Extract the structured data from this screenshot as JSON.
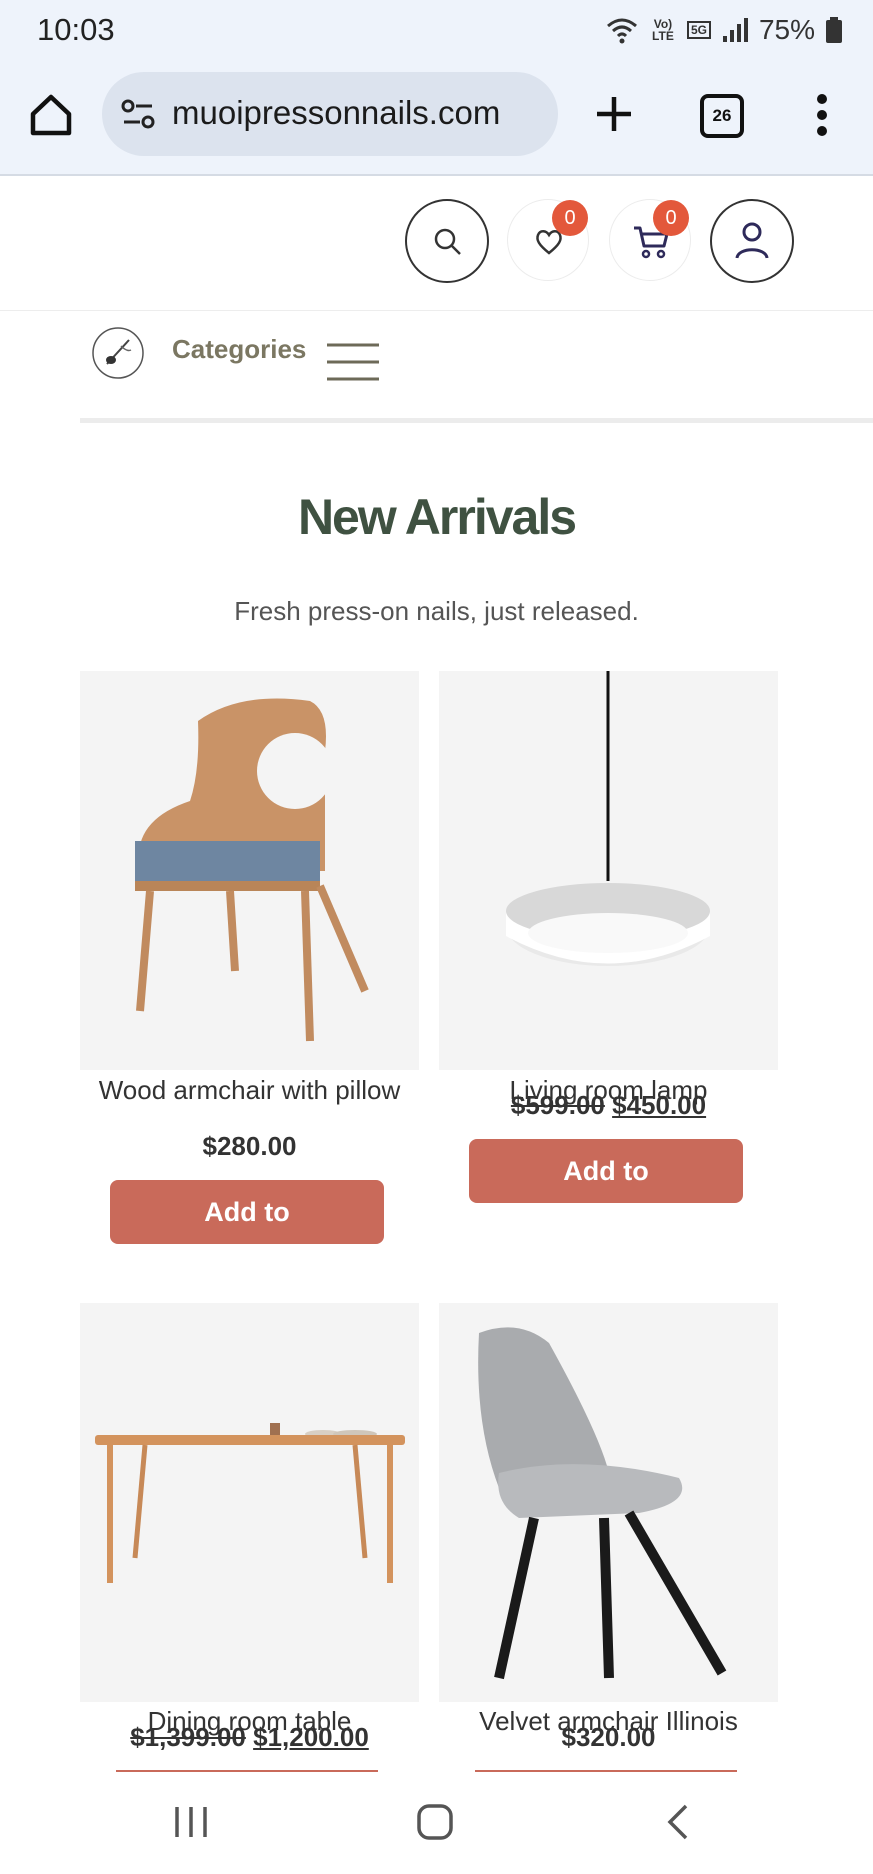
{
  "status_bar": {
    "time": "10:03",
    "network_type": "Vo) LTE",
    "network_5g": "5G",
    "battery": "75%",
    "icons": [
      "wifi-icon",
      "signal-icon",
      "battery-icon"
    ]
  },
  "browser": {
    "url": "muoipressonnails.com",
    "tab_count": "26",
    "icons": [
      "home-icon",
      "site-settings-icon",
      "new-tab-icon",
      "tabs-icon",
      "more-menu-icon"
    ]
  },
  "header": {
    "wishlist_count": "0",
    "cart_count": "0",
    "icons": [
      "search-icon",
      "heart-icon",
      "cart-icon",
      "account-icon"
    ]
  },
  "nav": {
    "categories_label": "Categories",
    "icons": [
      "logo-icon",
      "hamburger-icon"
    ]
  },
  "section": {
    "title": "New Arrivals",
    "subtitle": "Fresh press-on nails, just released."
  },
  "products": [
    {
      "name": "Wood armchair with pillow",
      "price": "$280.00",
      "old_price": "",
      "button": "Add to",
      "image": "wood-armchair-image"
    },
    {
      "name": "Living room lamp",
      "price": "$450.00",
      "old_price": "$599.00",
      "button": "Add to",
      "image": "pendant-lamp-image"
    },
    {
      "name": "Dining room table",
      "price": "$1,200.00",
      "old_price": "$1,399.00",
      "button": "",
      "image": "dining-table-image"
    },
    {
      "name": "Velvet armchair Illinois",
      "price": "$320.00",
      "old_price": "",
      "button": "",
      "image": "velvet-chair-image"
    }
  ],
  "colors": {
    "accent_button": "#c96a5a",
    "heading": "#3f5141",
    "badge": "#e3583b",
    "browser_chrome": "#eef3fb"
  }
}
